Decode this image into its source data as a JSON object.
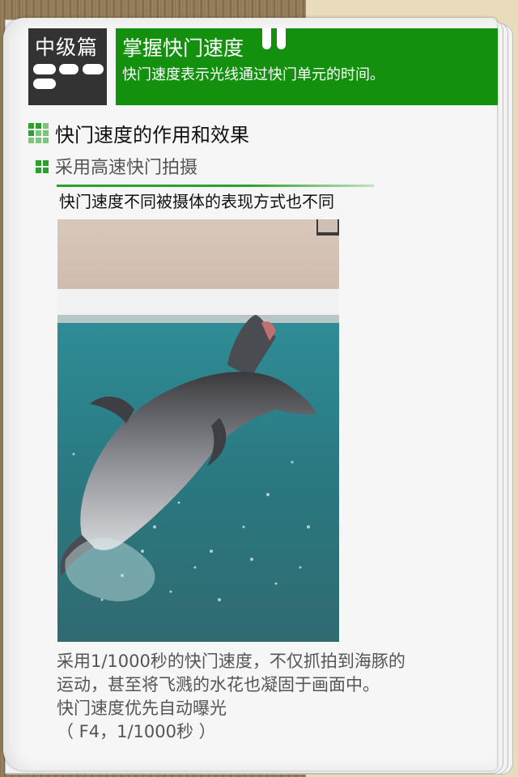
{
  "header": {
    "level_label": "中级篇",
    "title": "掌握快门速度",
    "subtitle": "快门速度表示光线通过快门单元的时间。"
  },
  "section": {
    "heading": "快门速度的作用和效果",
    "subheading": "采用高速快门拍摄"
  },
  "figure": {
    "title": "快门速度不同被摄体的表现方式也不同",
    "image_subject": "dolphin-jumping-photo"
  },
  "caption": {
    "line1": "采用1/1000秒的快门速度，不仅抓拍到海豚的",
    "line2": "运动，甚至将飞溅的水花也凝固于画面中。",
    "line3": "快门速度优先自动曝光",
    "line4": "（ F4，1/1000秒 ）"
  },
  "colors": {
    "accent_green": "#14900f",
    "level_bg": "#333333"
  }
}
